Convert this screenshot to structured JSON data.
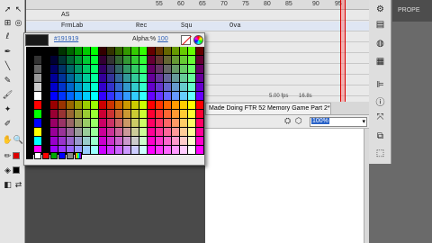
{
  "color_picker": {
    "hex": "#191919",
    "preview_color": "#191919",
    "alpha_label": "Alpha:%",
    "alpha_value": "100"
  },
  "timeline": {
    "ruler_numbers": [
      "55",
      "60",
      "65",
      "70",
      "75",
      "80",
      "85",
      "90",
      "95"
    ],
    "layers": [
      {
        "name": "AS"
      },
      {
        "name": "FrmLab"
      }
    ],
    "frame_labels": [
      "Rec",
      "Squ",
      "Ova"
    ],
    "status_left": "5.00 fps",
    "status_right": "16.8s"
  },
  "document": {
    "tab_title": "Made Doing FTR 52 Memory Game Part 2*",
    "zoom_value": "100%"
  },
  "right_panel": {
    "tab_label": "PROPE"
  }
}
